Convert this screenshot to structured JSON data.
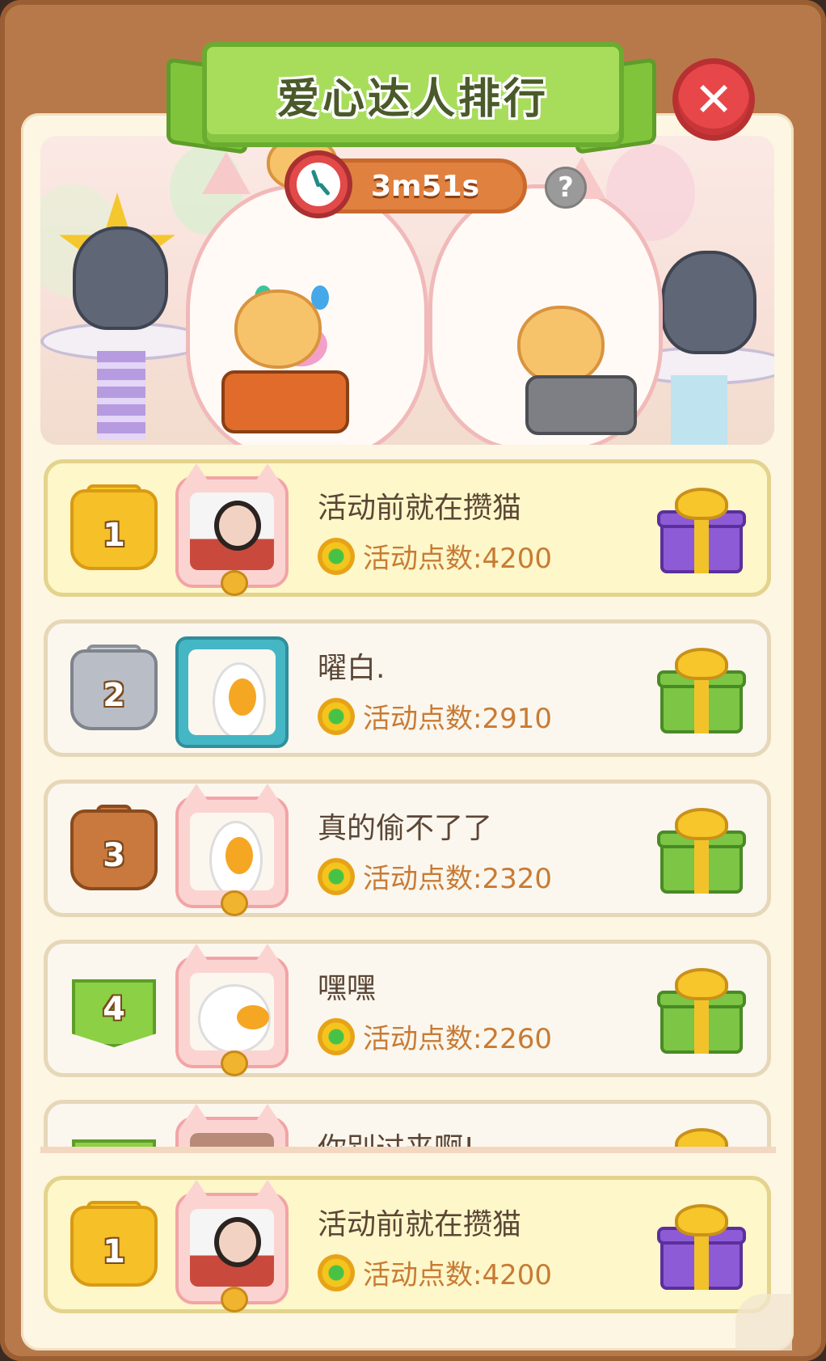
{
  "header": {
    "title": "爱心达人排行"
  },
  "timer": {
    "remaining": "3m51s"
  },
  "ranking": [
    {
      "rank": "1",
      "name": "活动前就在攒猫",
      "points_label": "活动点数:4200",
      "tier": "gold",
      "gift": "purple-gift-icon",
      "avatar_frame": "cat"
    },
    {
      "rank": "2",
      "name": "曜白.",
      "points_label": "活动点数:2910",
      "tier": "silver",
      "gift": "green-gift-icon",
      "avatar_frame": "plain"
    },
    {
      "rank": "3",
      "name": "真的偷不了了",
      "points_label": "活动点数:2320",
      "tier": "bronze",
      "gift": "green-gift-icon",
      "avatar_frame": "cat"
    },
    {
      "rank": "4",
      "name": "嘿嘿",
      "points_label": "活动点数:2260",
      "tier": "green",
      "gift": "green-gift-icon",
      "avatar_frame": "cat"
    },
    {
      "rank": "",
      "name": "你别过来啊!",
      "points_label": "",
      "tier": "green",
      "gift": "green-gift-icon",
      "avatar_frame": "cat"
    }
  ],
  "self_entry": {
    "rank": "1",
    "name": "活动前就在攒猫",
    "points_label": "活动点数:4200"
  },
  "colors": {
    "frame": "#b8794a",
    "panel": "#fdf6e3",
    "title_ribbon": "#a8dd5c",
    "timer": "#e0813f",
    "close": "#e8474a",
    "points_text": "#c87b35"
  }
}
